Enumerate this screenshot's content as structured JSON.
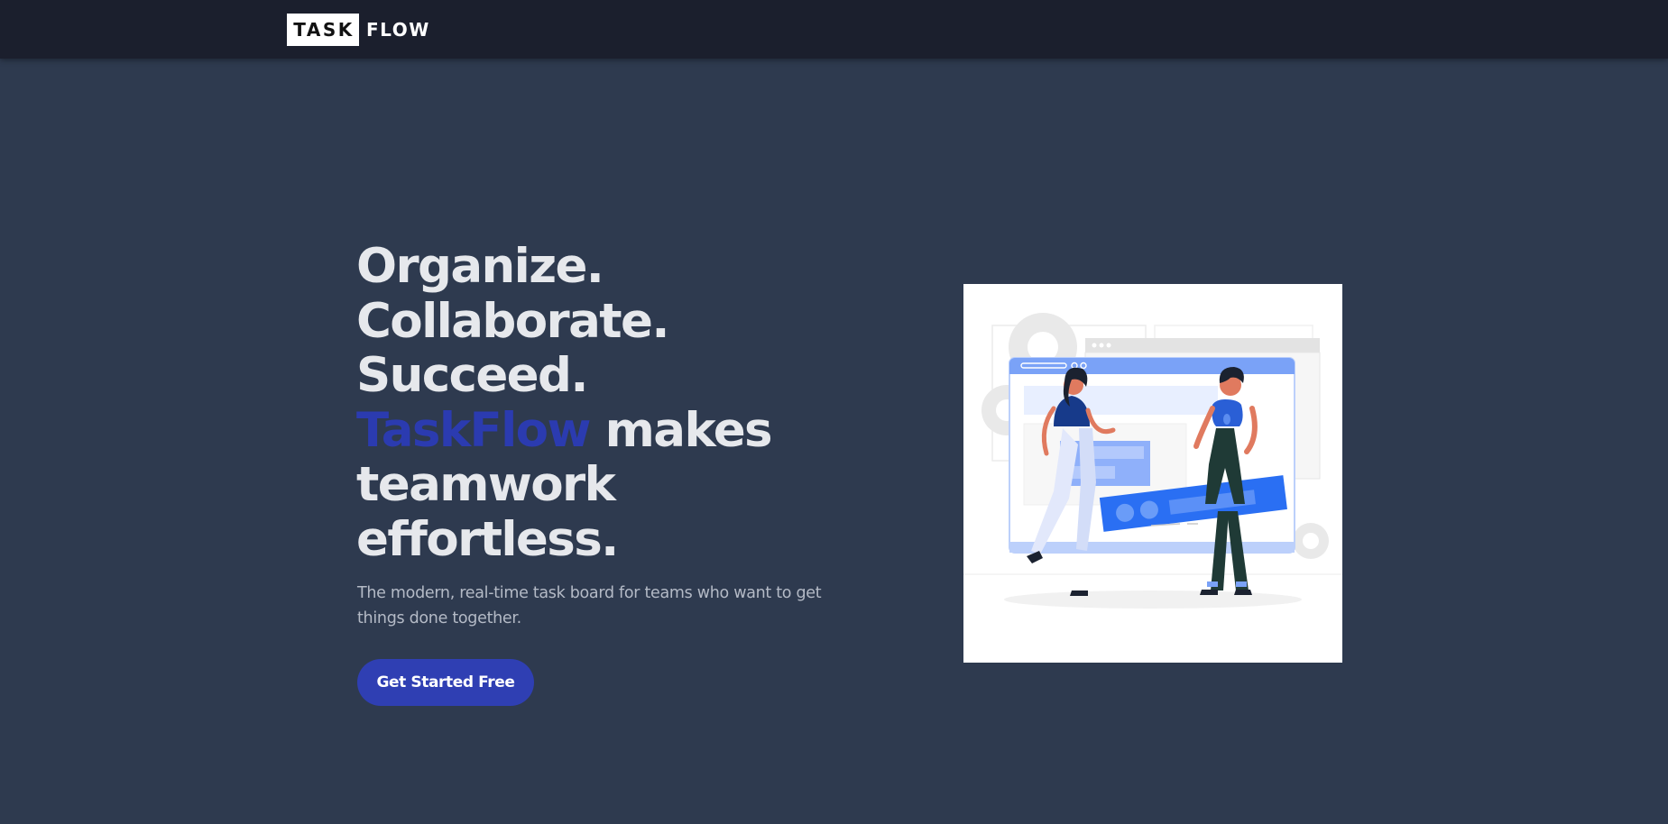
{
  "nav": {
    "logo_task": "TASK",
    "logo_flow": "FLOW"
  },
  "hero": {
    "heading_line1": "Organize.",
    "heading_line2": "Collaborate.",
    "heading_line3": "Succeed.",
    "heading_accent": "TaskFlow",
    "heading_line4_rest": " makes",
    "heading_line5": "teamwork",
    "heading_line6": "effortless.",
    "subtitle": "The modern, real-time task board for teams who want to get things done together.",
    "cta_label": "Get Started Free",
    "illustration_name": "teamwork-illustration"
  },
  "colors": {
    "background": "#2e3a4f",
    "navbar": "#1b1f2d",
    "accent": "#2b3bb0",
    "button": "#2f3fb3",
    "heading": "#e6e8ec",
    "subtitle": "#b4bac6"
  }
}
